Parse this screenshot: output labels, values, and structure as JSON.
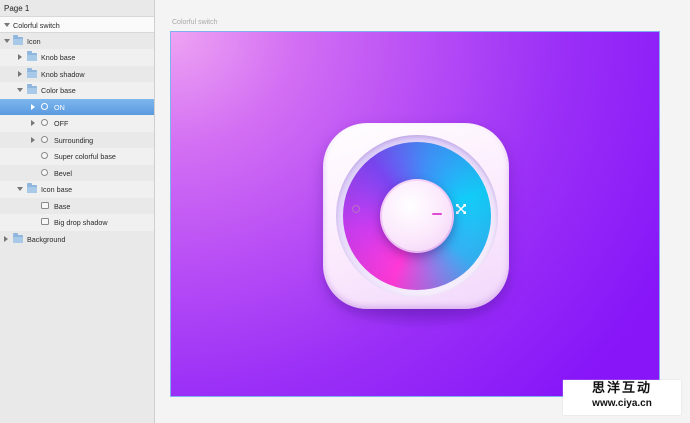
{
  "page_label": "Page 1",
  "canvas_title": "Colorful switch",
  "layers": [
    {
      "label": "Colorful switch",
      "kind": "artboard"
    },
    {
      "label": "Icon",
      "kind": "folder"
    },
    {
      "label": "Knob base",
      "kind": "folder"
    },
    {
      "label": "Knob shadow",
      "kind": "folder"
    },
    {
      "label": "Color base",
      "kind": "folder"
    },
    {
      "label": "ON",
      "kind": "oval-group",
      "selected": true
    },
    {
      "label": "OFF",
      "kind": "oval-group"
    },
    {
      "label": "Surrounding",
      "kind": "oval-group"
    },
    {
      "label": "Super colorful base",
      "kind": "oval"
    },
    {
      "label": "Bevel",
      "kind": "oval"
    },
    {
      "label": "Icon base",
      "kind": "folder"
    },
    {
      "label": "Base",
      "kind": "rect"
    },
    {
      "label": "Big drop shadow",
      "kind": "rect"
    },
    {
      "label": "Background",
      "kind": "folder"
    }
  ],
  "colors": {
    "selection": "#6aa6e8",
    "artboard_start": "#eea4f3",
    "artboard_end": "#8715f8",
    "ring_pink": "#ff39d6",
    "ring_cyan": "#12ccf8"
  },
  "watermark": {
    "chinese": "思洋互动",
    "url": "www.ciya.cn"
  }
}
